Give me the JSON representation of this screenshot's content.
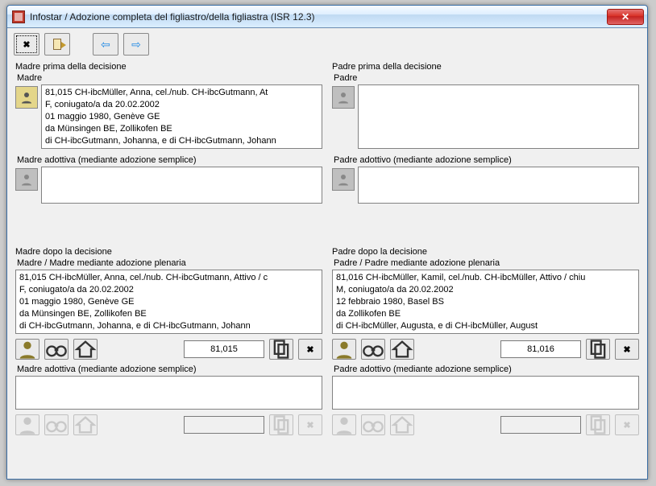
{
  "window": {
    "title": "Infostar / Adozione completa del figliastro/della figliastra (ISR 12.3)"
  },
  "toolbar": {
    "close_tip": "Chiudi",
    "exit_tip": "Esci",
    "back_tip": "Indietro",
    "forward_tip": "Avanti"
  },
  "mother_before": {
    "section": "Madre prima della decisione",
    "label": "Madre",
    "lines": {
      "l1": "81,015  CH-ibcMüller, Anna, cel./nub. CH-ibcGutmann, At",
      "l2": "F, coniugato/a da 20.02.2002",
      "l3": "01 maggio 1980, Genève GE",
      "l4": "da Münsingen BE, Zollikofen BE",
      "l5": "di CH-ibcGutmann, Johanna, e di CH-ibcGutmann, Johann"
    },
    "adoptive_label": "Madre adottiva (mediante adozione semplice)"
  },
  "father_before": {
    "section": "Padre prima della decisione",
    "label": "Padre",
    "adoptive_label": "Padre adottivo (mediante adozione semplice)"
  },
  "mother_after": {
    "section": "Madre dopo la decisione",
    "label": "Madre / Madre mediante adozione plenaria",
    "lines": {
      "l1": "81,015  CH-ibcMüller, Anna, cel./nub. CH-ibcGutmann, Attivo / c",
      "l2": "F, coniugato/a da 20.02.2002",
      "l3": "01 maggio 1980, Genève GE",
      "l4": "da Münsingen BE, Zollikofen BE",
      "l5": "di CH-ibcGutmann, Johanna, e di CH-ibcGutmann, Johann"
    },
    "id": "81,015",
    "adoptive_label": "Madre adottiva (mediante adozione semplice)"
  },
  "father_after": {
    "section": "Padre dopo la decisione",
    "label": "Padre / Padre mediante adozione plenaria",
    "lines": {
      "l1": "81,016  CH-ibcMüller, Kamil, cel./nub. CH-ibcMüller, Attivo / chiu",
      "l2": "M, coniugato/a da 20.02.2002",
      "l3": "12 febbraio 1980, Basel BS",
      "l4": "da Zollikofen BE",
      "l5": "di CH-ibcMüller, Augusta, e di CH-ibcMüller, August"
    },
    "id": "81,016",
    "adoptive_label": "Padre adottivo (mediante adozione semplice)"
  }
}
